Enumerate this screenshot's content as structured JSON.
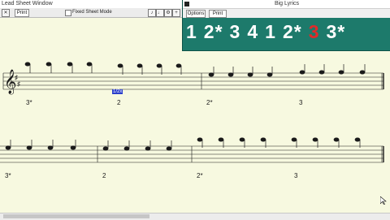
{
  "lead_window": {
    "title": "Lead Sheet Window",
    "toolbar": {
      "print_label": "Print",
      "checkbox_label": "Fixed Sheet Mode",
      "icons": [
        "x-icon",
        "chord-icon",
        "note-icon",
        "gear-icon",
        "grid-icon",
        "plus-icon"
      ]
    }
  },
  "lyrics_window": {
    "title": "Big Lyrics",
    "options_label": "Options",
    "print_label": "Print",
    "tokens": [
      "1",
      "2*",
      "3",
      "4",
      "1",
      "2*",
      "3",
      "3*"
    ],
    "current_index": 6,
    "colors": {
      "background": "#1d7a6b",
      "text": "#ffffff",
      "highlight": "#e02a2a"
    }
  },
  "chords": {
    "row1": [
      "3*",
      "2",
      "2*",
      "3"
    ],
    "row2": [
      "3*",
      "2",
      "2*",
      "3"
    ],
    "highlight_label": "1/2x"
  }
}
